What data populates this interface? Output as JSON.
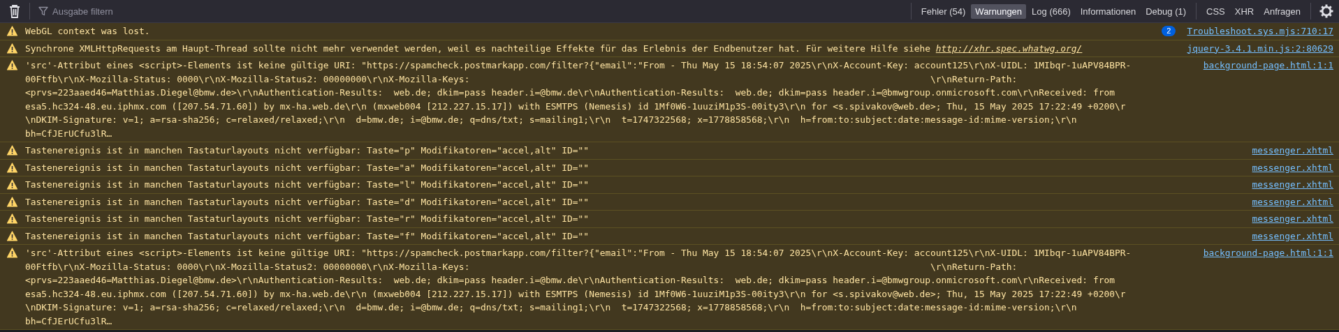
{
  "toolbar": {
    "filter": {
      "placeholder": "Ausgabe filtern"
    },
    "filters": [
      {
        "label": "Fehler (54)",
        "selected": false
      },
      {
        "label": "Warnungen",
        "selected": true
      },
      {
        "label": "Log (666)",
        "selected": false
      },
      {
        "label": "Informationen",
        "selected": false
      },
      {
        "label": "Debug (1)",
        "selected": false
      }
    ],
    "request_filters": [
      {
        "label": "CSS",
        "selected": false
      },
      {
        "label": "XHR",
        "selected": false
      },
      {
        "label": "Anfragen",
        "selected": false
      }
    ]
  },
  "messages": [
    {
      "kind": "warning",
      "lines": [
        "WebGL context was lost."
      ],
      "repeat_count": "2",
      "source": "Troubleshoot.sys.mjs:710:17"
    },
    {
      "kind": "warning",
      "lines": [
        "Synchrone XMLHttpRequests am Haupt-Thread sollte nicht mehr verwendet werden, weil es nachteilige Effekte für das Erlebnis der Endbenutzer hat. Für weitere Hilfe siehe "
      ],
      "link": "http://xhr.spec.whatwg.org/",
      "source": "jquery-3.4.1.min.js:2:80629"
    },
    {
      "kind": "warning",
      "lines": [
        "'src'-Attribut eines <script>-Elements ist keine gültige URI: \"https://spamcheck.postmarkapp.com/filter?{\"email\":\"From - Thu May 15 18:54:07 2025\\r\\nX-Account-Key: account125\\r\\nX-UIDL: 1MIbqr-1uAPV84BPR-",
        "00Ftfb\\r\\nX-Mozilla-Status: 0000\\r\\nX-Mozilla-Status2: 00000000\\r\\nX-Mozilla-Keys:                                                                                     \\r\\nReturn-Path:",
        "<prvs=223aaed46=Matthias.Diegel@bmw.de>\\r\\nAuthentication-Results:  web.de; dkim=pass header.i=@bmw.de\\r\\nAuthentication-Results:  web.de; dkim=pass header.i=@bmwgroup.onmicrosoft.com\\r\\nReceived: from",
        "esa5.hc324-48.eu.iphmx.com ([207.54.71.60]) by mx-ha.web.de\\r\\n (mxweb004 [212.227.15.17]) with ESMTPS (Nemesis) id 1Mf0W6-1uuziM1p3S-00ity3\\r\\n for <s.spivakov@web.de>; Thu, 15 May 2025 17:22:49 +0200\\r",
        "\\nDKIM-Signature: v=1; a=rsa-sha256; c=relaxed/relaxed;\\r\\n  d=bmw.de; i=@bmw.de; q=dns/txt; s=mailing1;\\r\\n  t=1747322568; x=1778858568;\\r\\n  h=from:to:subject:date:message-id:mime-version;\\r\\n",
        "bh=CfJErUCfu3lR…"
      ],
      "source": "background-page.html:1:1"
    },
    {
      "kind": "warning",
      "lines": [
        "Tastenereignis ist in manchen Tastaturlayouts nicht verfügbar: Taste=\"p\" Modifikatoren=\"accel,alt\" ID=\"\""
      ],
      "source": "messenger.xhtml"
    },
    {
      "kind": "warning",
      "lines": [
        "Tastenereignis ist in manchen Tastaturlayouts nicht verfügbar: Taste=\"a\" Modifikatoren=\"accel,alt\" ID=\"\""
      ],
      "source": "messenger.xhtml"
    },
    {
      "kind": "warning",
      "lines": [
        "Tastenereignis ist in manchen Tastaturlayouts nicht verfügbar: Taste=\"l\" Modifikatoren=\"accel,alt\" ID=\"\""
      ],
      "source": "messenger.xhtml"
    },
    {
      "kind": "warning",
      "lines": [
        "Tastenereignis ist in manchen Tastaturlayouts nicht verfügbar: Taste=\"d\" Modifikatoren=\"accel,alt\" ID=\"\""
      ],
      "source": "messenger.xhtml"
    },
    {
      "kind": "warning",
      "lines": [
        "Tastenereignis ist in manchen Tastaturlayouts nicht verfügbar: Taste=\"r\" Modifikatoren=\"accel,alt\" ID=\"\""
      ],
      "source": "messenger.xhtml"
    },
    {
      "kind": "warning",
      "lines": [
        "Tastenereignis ist in manchen Tastaturlayouts nicht verfügbar: Taste=\"f\" Modifikatoren=\"accel,alt\" ID=\"\""
      ],
      "source": "messenger.xhtml"
    },
    {
      "kind": "warning",
      "lines": [
        "'src'-Attribut eines <script>-Elements ist keine gültige URI: \"https://spamcheck.postmarkapp.com/filter?{\"email\":\"From - Thu May 15 18:54:07 2025\\r\\nX-Account-Key: account125\\r\\nX-UIDL: 1MIbqr-1uAPV84BPR-",
        "00Ftfb\\r\\nX-Mozilla-Status: 0000\\r\\nX-Mozilla-Status2: 00000000\\r\\nX-Mozilla-Keys:                                                                                     \\r\\nReturn-Path:",
        "<prvs=223aaed46=Matthias.Diegel@bmw.de>\\r\\nAuthentication-Results:  web.de; dkim=pass header.i=@bmw.de\\r\\nAuthentication-Results:  web.de; dkim=pass header.i=@bmwgroup.onmicrosoft.com\\r\\nReceived: from",
        "esa5.hc324-48.eu.iphmx.com ([207.54.71.60]) by mx-ha.web.de\\r\\n (mxweb004 [212.227.15.17]) with ESMTPS (Nemesis) id 1Mf0W6-1uuziM1p3S-00ity3\\r\\n for <s.spivakov@web.de>; Thu, 15 May 2025 17:22:49 +0200\\r",
        "\\nDKIM-Signature: v=1; a=rsa-sha256; c=relaxed/relaxed;\\r\\n  d=bmw.de; i=@bmw.de; q=dns/txt; s=mailing1;\\r\\n  t=1747322568; x=1778858568;\\r\\n  h=from:to:subject:date:message-id:mime-version;\\r\\n",
        "bh=CfJErUCfu3lR…"
      ],
      "source": "background-page.html:1:1"
    }
  ]
}
